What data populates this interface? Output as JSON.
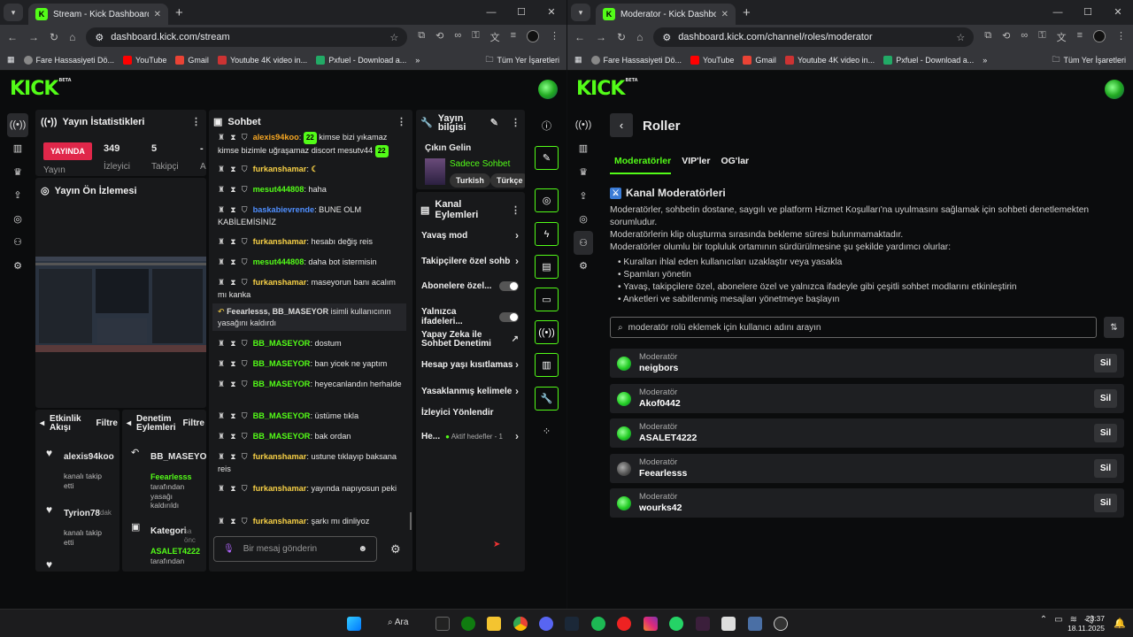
{
  "colors": {
    "accent": "#53fc18",
    "live": "#e0274a",
    "bg": "#0b0c0d"
  },
  "left_window": {
    "tab_title": "Stream - Kick Dashboard",
    "url": "dashboard.kick.com/stream",
    "bookmarks": [
      "Fare Hassasiyeti Dö...",
      "YouTube",
      "Gmail",
      "Youtube 4K video in...",
      "Pxfuel - Download a..."
    ],
    "bookmarks_more": "Tüm Yer İşaretleri",
    "logo": "KICK",
    "logo_beta": "BETA",
    "stats": {
      "title": "Yayın İstatistikleri",
      "live": "YAYINDA",
      "live_label": "Yayın",
      "viewers": "349",
      "viewers_label": "İzleyici",
      "followers": "5",
      "followers_label": "Takipçi",
      "extra": "-",
      "extra_label": "A"
    },
    "preview_title": "Yayın Ön İzlemesi",
    "activity": {
      "title": "Etkinlik Akışı",
      "filter": "Filtre",
      "items": [
        {
          "user": "alexis94koo",
          "text": "kanalı takip etti"
        },
        {
          "user": "Tyrion78",
          "text": "kanalı takip etti",
          "extra": "dak"
        }
      ]
    },
    "mod_actions": {
      "title": "Denetim Eylemleri",
      "filter": "Filtre",
      "items": [
        {
          "user": "BB_MASEYO",
          "actor": "Feearlesss",
          "text": "tarafından yasağı kaldırıldı"
        },
        {
          "user": "Kategori",
          "actor": "ASALET4222",
          "text": "tarafından",
          "extra": "sa önc"
        }
      ]
    },
    "chat": {
      "title": "Sohbet",
      "lines": [
        {
          "user": "alexis94koo",
          "msg": "kimse bizi yıkamaz kimse bizimle uğraşamaz discort mesutv44",
          "color": "orange"
        },
        {
          "user": "furkanshamar",
          "msg": "",
          "color": "yel"
        },
        {
          "user": "mesut444808",
          "msg": "haha",
          "color": "green"
        },
        {
          "user": "baskabievrende",
          "msg": "BUNE OLM KABİLEMİSİNİZ",
          "color": "blue"
        },
        {
          "user": "furkanshamar",
          "msg": "hesabı değiş reis",
          "color": "yel"
        },
        {
          "user": "mesut444808",
          "msg": "daha bot istermisin",
          "color": "green"
        },
        {
          "user": "furkanshamar",
          "msg": "maseyorun banı acalım mı kanka",
          "color": "yel"
        },
        {
          "user": "BB_MASEYOR",
          "msg": "dostum",
          "color": "green"
        },
        {
          "user": "BB_MASEYOR",
          "msg": "ban yicek ne yaptım",
          "color": "green"
        },
        {
          "user": "BB_MASEYOR",
          "msg": "heyecanlandın herhalde",
          "color": "green"
        },
        {
          "user": "BB_MASEYOR",
          "msg": "üstüme tıkla",
          "color": "green"
        },
        {
          "user": "BB_MASEYOR",
          "msg": "bak ordan",
          "color": "green"
        },
        {
          "user": "furkanshamar",
          "msg": "ustune tıklayıp baksana reis",
          "color": "yel"
        },
        {
          "user": "furkanshamar",
          "msg": "yayında napıyosun peki",
          "color": "yel"
        },
        {
          "user": "furkanshamar",
          "msg": "şarkı mı dinliyoz",
          "color": "yel"
        }
      ],
      "system_msg_users": "Feearlesss, BB_MASEYOR",
      "system_msg_text": "isimli kullanıcının yasağını kaldırdı",
      "emote1": "22",
      "emote2": "22",
      "input_placeholder": "Bir mesaj gönderin"
    },
    "stream_info": {
      "title": "Yayın bilgisi",
      "stream_title": "Çıkın Gelin",
      "category": "Sadece Sohbet",
      "tags": [
        "Turkish",
        "Türkçe"
      ]
    },
    "channel_actions": {
      "title": "Kanal Eylemleri",
      "items": [
        {
          "label": "Yavaş mod",
          "kind": "chevron"
        },
        {
          "label": "Takipçilere özel sohb",
          "kind": "chevron"
        },
        {
          "label": "Abonelere özel...",
          "kind": "toggle"
        },
        {
          "label": "Yalnızca ifadeleri...",
          "kind": "toggle"
        },
        {
          "label": "Yapay Zeka ile Sohbet Denetimi",
          "kind": "external"
        },
        {
          "label": "Hesap yaşı kısıtlamas",
          "kind": "chevron"
        },
        {
          "label": "Yasaklanmış kelimele",
          "kind": "chevron"
        },
        {
          "label": "İzleyici Yönlendir",
          "kind": "none"
        },
        {
          "label": "He...",
          "kind": "chevron",
          "sub": "Aktif hedefler - 1"
        }
      ]
    }
  },
  "right_window": {
    "tab_title": "Moderator - Kick Dashboard",
    "url": "dashboard.kick.com/channel/roles/moderator",
    "bookmarks": [
      "Fare Hassasiyeti Dö...",
      "YouTube",
      "Gmail",
      "Youtube 4K video in...",
      "Pxfuel - Download a..."
    ],
    "bookmarks_more": "Tüm Yer İşaretleri",
    "logo": "KICK",
    "logo_beta": "BETA",
    "page_title": "Roller",
    "tabs": [
      "Moderatörler",
      "VIP'ler",
      "OG'lar"
    ],
    "section_title": "Kanal Moderatörleri",
    "desc1": "Moderatörler, sohbetin dostane, saygılı ve platform Hizmet Koşulları'na uyulmasını sağlamak için sohbeti denetlemekten sorumludur.",
    "desc2": "Moderatörlerin klip oluşturma sırasında bekleme süresi bulunmamaktadır.",
    "desc3": "Moderatörler olumlu bir topluluk ortamının sürdürülmesine şu şekilde yardımcı olurlar:",
    "bullets": [
      "Kuralları ihlal eden kullanıcıları uzaklaştır veya yasakla",
      "Spamları yönetin",
      "Yavaş, takipçilere özel, abonelere özel ve yalnızca ifadeyle gibi çeşitli sohbet modlarını etkinleştirin",
      "Anketleri ve sabitlenmiş mesajları yönetmeye başlayın"
    ],
    "search_placeholder": "moderatör rolü eklemek için kullanıcı adını arayın",
    "role_label": "Moderatör",
    "remove_label": "Sil",
    "moderators": [
      "neigbors",
      "Akof0442",
      "ASALET4222",
      "Feearlesss",
      "wourks42"
    ]
  },
  "taskbar": {
    "search": "Ara",
    "time": "23:37",
    "date": "18.11.2025"
  }
}
